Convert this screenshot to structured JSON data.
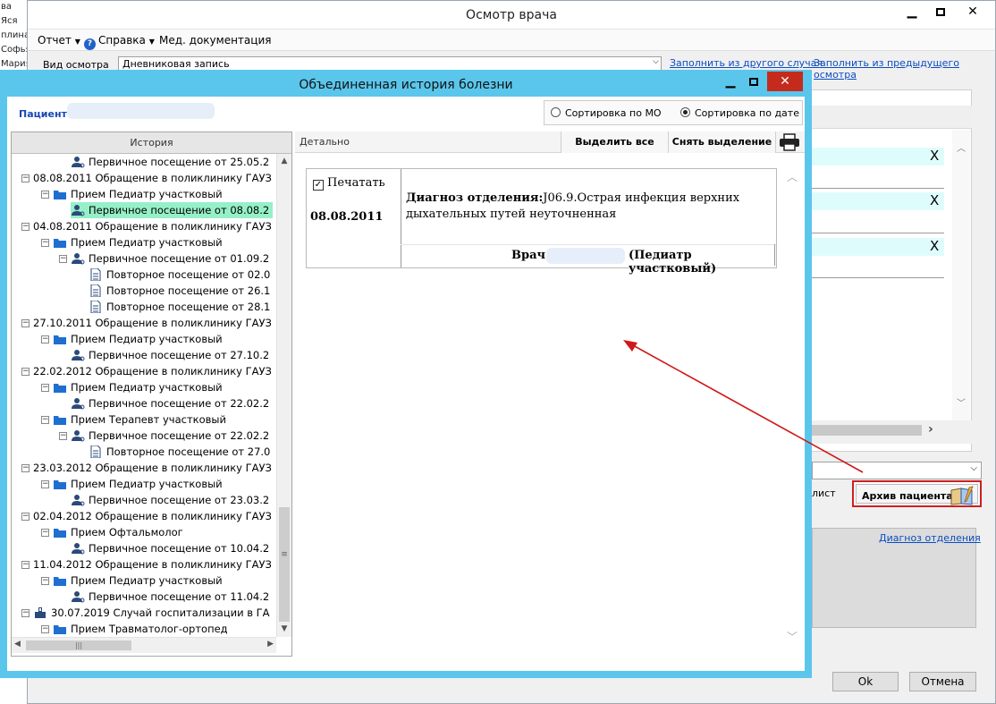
{
  "background_names": [
    "ва Яся",
    "плина",
    "Софья",
    "Мария"
  ],
  "outer_window": {
    "title": "Осмотр врача",
    "menu": {
      "report": "Отчет",
      "help": "Справка",
      "med_docs": "Мед. документация"
    },
    "exam_type_label": "Вид осмотра",
    "exam_type_value": "Дневниковая запись",
    "link_fill_other": "Заполнить из другого случая",
    "link_fill_prev": "Заполнить из предыдущего осмотра",
    "right_rows_x": [
      "X",
      "X",
      "X"
    ],
    "list_label": "лист",
    "archive_button": "Архив пациента",
    "diag_link": "Диагноз отделения",
    "ok_button": "Ok",
    "cancel_button": "Отмена"
  },
  "dialog": {
    "title": "Объединенная история болезни",
    "patient_label": "Пациент",
    "sort_by_mo": "Сортировка по МО",
    "sort_by_date": "Сортировка по дате",
    "sort_selected": "date",
    "history_header": "История",
    "detail_header": "Детально",
    "select_all": "Выделить все",
    "deselect": "Снять выделение",
    "tree": [
      {
        "level": 3,
        "icon": "doctor",
        "text": "Первичное посещение от 25.05.2"
      },
      {
        "level": 1,
        "icon": "none",
        "toggle": "−",
        "text": "08.08.2011  Обращение в поликлинику ГАУЗ"
      },
      {
        "level": 2,
        "icon": "folder",
        "toggle": "−",
        "text": "Прием Педиатр участковый"
      },
      {
        "level": 3,
        "icon": "doctor",
        "text": "Первичное посещение от 08.08.2",
        "selected": true
      },
      {
        "level": 1,
        "icon": "none",
        "toggle": "−",
        "text": "04.08.2011  Обращение в поликлинику ГАУЗ"
      },
      {
        "level": 2,
        "icon": "folder",
        "toggle": "−",
        "text": "Прием Педиатр участковый"
      },
      {
        "level": 3,
        "icon": "doctor",
        "toggle": "−",
        "text": "Первичное посещение от 01.09.2"
      },
      {
        "level": 4,
        "icon": "doc",
        "text": "Повторное посещение от 02.0"
      },
      {
        "level": 4,
        "icon": "doc",
        "text": "Повторное посещение от 26.1"
      },
      {
        "level": 4,
        "icon": "doc",
        "text": "Повторное посещение от 28.1"
      },
      {
        "level": 1,
        "icon": "none",
        "toggle": "−",
        "text": "27.10.2011  Обращение в поликлинику ГАУЗ"
      },
      {
        "level": 2,
        "icon": "folder",
        "toggle": "−",
        "text": "Прием Педиатр участковый"
      },
      {
        "level": 3,
        "icon": "doctor",
        "text": "Первичное посещение от 27.10.2"
      },
      {
        "level": 1,
        "icon": "none",
        "toggle": "−",
        "text": "22.02.2012  Обращение в поликлинику ГАУЗ"
      },
      {
        "level": 2,
        "icon": "folder",
        "toggle": "−",
        "text": "Прием Педиатр участковый"
      },
      {
        "level": 3,
        "icon": "doctor",
        "text": "Первичное посещение от 22.02.2"
      },
      {
        "level": 2,
        "icon": "folder",
        "toggle": "−",
        "text": "Прием Терапевт участковый"
      },
      {
        "level": 3,
        "icon": "doctor",
        "toggle": "−",
        "text": "Первичное посещение от 22.02.2"
      },
      {
        "level": 4,
        "icon": "doc",
        "text": "Повторное посещение от 27.0"
      },
      {
        "level": 1,
        "icon": "none",
        "toggle": "−",
        "text": "23.03.2012  Обращение в поликлинику ГАУЗ"
      },
      {
        "level": 2,
        "icon": "folder",
        "toggle": "−",
        "text": "Прием Педиатр участковый"
      },
      {
        "level": 3,
        "icon": "doctor",
        "text": "Первичное посещение от 23.03.2"
      },
      {
        "level": 1,
        "icon": "none",
        "toggle": "−",
        "text": "02.04.2012  Обращение в поликлинику ГАУЗ"
      },
      {
        "level": 2,
        "icon": "folder",
        "toggle": "−",
        "text": "Прием Офтальмолог"
      },
      {
        "level": 3,
        "icon": "doctor",
        "text": "Первичное посещение от 10.04.2"
      },
      {
        "level": 1,
        "icon": "none",
        "toggle": "−",
        "text": "11.04.2012  Обращение в поликлинику ГАУЗ"
      },
      {
        "level": 2,
        "icon": "folder",
        "toggle": "−",
        "text": "Прием Педиатр участковый"
      },
      {
        "level": 3,
        "icon": "doctor",
        "text": "Первичное посещение от 11.04.2"
      },
      {
        "level": 1,
        "icon": "hospital",
        "toggle": "−",
        "text": "30.07.2019  Случай госпитализации в ГА"
      },
      {
        "level": 2,
        "icon": "folder",
        "toggle": "−",
        "text": "Прием Травматолог-ортопед"
      }
    ],
    "card": {
      "print_label": "Печатать",
      "date": "08.08.2011",
      "diag_label": "Диагноз отделения:",
      "diag_text": "J06.9.Острая инфекция верхних дыхательных путей неуточненная",
      "doctor_label": "Врач",
      "doctor_role": "(Педиатр участковый)"
    }
  },
  "colors": {
    "dialog_frame": "#5bc6ec",
    "selected_row": "#96f0c7",
    "close_btn": "#c42b1c",
    "arrow": "#d01818"
  }
}
